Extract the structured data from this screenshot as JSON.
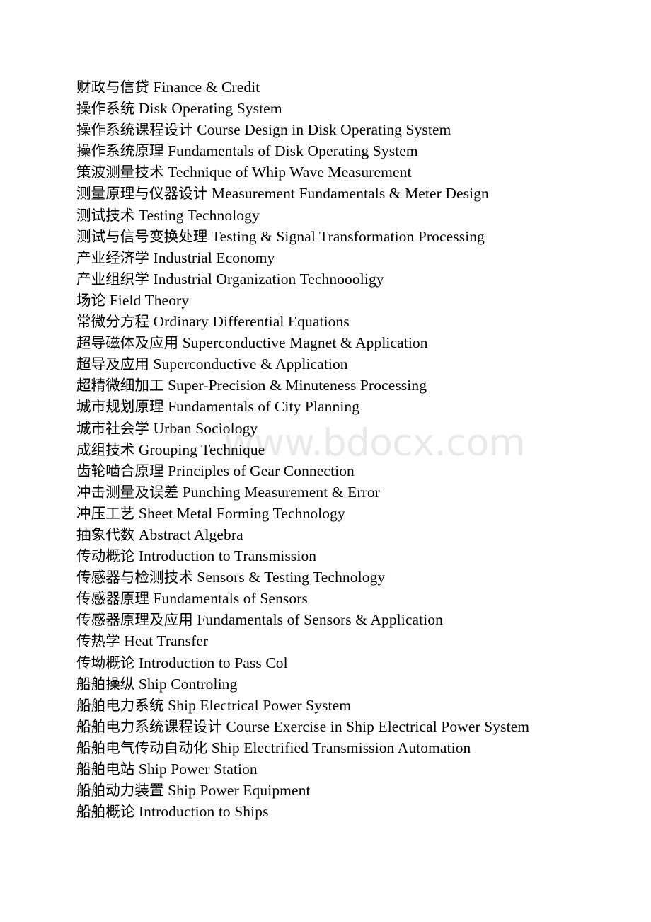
{
  "document": {
    "type": "glossary-list",
    "language_pair": "Chinese-English",
    "watermark": "www.bdocx.com",
    "entries": [
      {
        "zh": "财政与信贷",
        "en": "Finance & Credit"
      },
      {
        "zh": "操作系统",
        "en": "Disk Operating System"
      },
      {
        "zh": "操作系统课程设计",
        "en": "Course Design in Disk Operating System"
      },
      {
        "zh": "操作系统原理",
        "en": "Fundamentals of Disk Operating System"
      },
      {
        "zh": "策波测量技术",
        "en": "Technique of Whip Wave Measurement"
      },
      {
        "zh": "测量原理与仪器设计",
        "en": "Measurement Fundamentals & Meter Design"
      },
      {
        "zh": "测试技术",
        "en": "Testing Technology"
      },
      {
        "zh": "测试与信号变换处理",
        "en": "Testing & Signal Transformation Processing"
      },
      {
        "zh": "产业经济学",
        "en": "Industrial Economy"
      },
      {
        "zh": "产业组织学",
        "en": "Industrial Organization Technoooligy"
      },
      {
        "zh": "场论",
        "en": "Field Theory"
      },
      {
        "zh": "常微分方程",
        "en": "Ordinary Differential Equations"
      },
      {
        "zh": "超导磁体及应用",
        "en": "Superconductive Magnet & Application"
      },
      {
        "zh": "超导及应用",
        "en": "Superconductive & Application"
      },
      {
        "zh": "超精微细加工",
        "en": "Super-Precision & Minuteness Processing"
      },
      {
        "zh": "城市规划原理",
        "en": "Fundamentals of City Planning"
      },
      {
        "zh": "城市社会学",
        "en": "Urban Sociology"
      },
      {
        "zh": "成组技术",
        "en": "Grouping Technique"
      },
      {
        "zh": "齿轮啮合原理",
        "en": "Principles of Gear Connection"
      },
      {
        "zh": "冲击测量及误差",
        "en": "Punching Measurement & Error"
      },
      {
        "zh": "冲压工艺",
        "en": "Sheet Metal Forming Technology"
      },
      {
        "zh": "抽象代数",
        "en": "Abstract Algebra"
      },
      {
        "zh": "传动概论",
        "en": "Introduction to Transmission"
      },
      {
        "zh": "传感器与检测技术",
        "en": "Sensors & Testing Technology"
      },
      {
        "zh": "传感器原理",
        "en": "Fundamentals of Sensors"
      },
      {
        "zh": "传感器原理及应用",
        "en": "Fundamentals of Sensors & Application"
      },
      {
        "zh": "传热学",
        "en": "Heat Transfer"
      },
      {
        "zh": "传坳概论",
        "en": "Introduction to Pass Col"
      },
      {
        "zh": "船舶操纵",
        "en": "Ship Controling"
      },
      {
        "zh": "船舶电力系统",
        "en": "Ship Electrical Power System"
      },
      {
        "zh": "船舶电力系统课程设计",
        "en": "Course Exercise in Ship Electrical Power System"
      },
      {
        "zh": "船舶电气传动自动化",
        "en": "Ship Electrified Transmission Automation"
      },
      {
        "zh": "船舶电站",
        "en": "Ship Power Station"
      },
      {
        "zh": "船舶动力装置",
        "en": "Ship Power Equipment"
      },
      {
        "zh": "船舶概论",
        "en": "Introduction to Ships"
      }
    ]
  }
}
